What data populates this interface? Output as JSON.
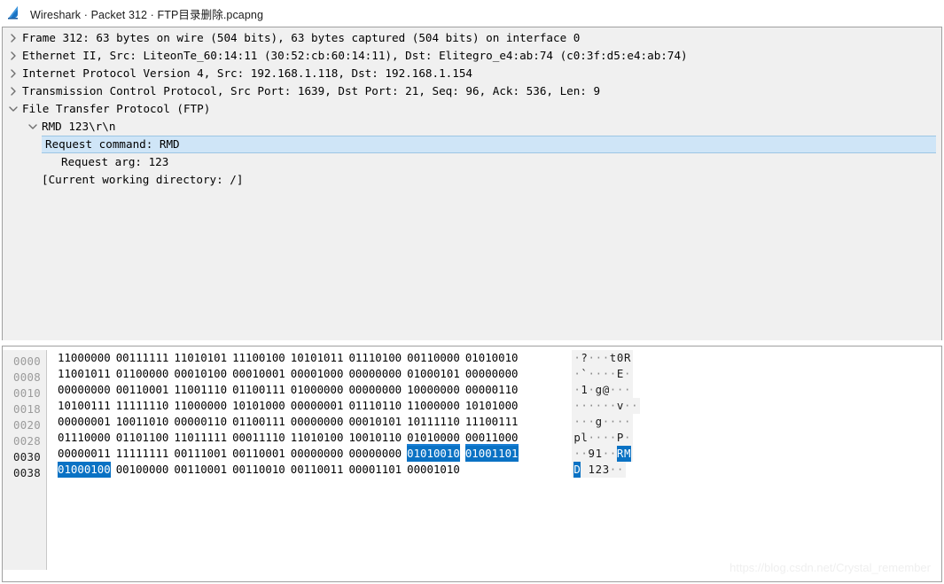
{
  "window": {
    "title": "Wireshark · Packet 312 · FTP目录删除.pcapng",
    "icon": "wireshark-fin-icon"
  },
  "detail_tree": {
    "rows": [
      {
        "indent": 0,
        "state": "collapsed",
        "text": "Frame 312: 63 bytes on wire (504 bits), 63 bytes captured (504 bits) on interface 0",
        "selected": false
      },
      {
        "indent": 0,
        "state": "collapsed",
        "text": "Ethernet II, Src: LiteonTe_60:14:11 (30:52:cb:60:14:11), Dst: Elitegro_e4:ab:74 (c0:3f:d5:e4:ab:74)",
        "selected": false
      },
      {
        "indent": 0,
        "state": "collapsed",
        "text": "Internet Protocol Version 4, Src: 192.168.1.118, Dst: 192.168.1.154",
        "selected": false
      },
      {
        "indent": 0,
        "state": "collapsed",
        "text": "Transmission Control Protocol, Src Port: 1639, Dst Port: 21, Seq: 96, Ack: 536, Len: 9",
        "selected": false
      },
      {
        "indent": 0,
        "state": "expanded",
        "text": "File Transfer Protocol (FTP)",
        "selected": false
      },
      {
        "indent": 1,
        "state": "expanded",
        "text": "RMD 123\\r\\n",
        "selected": false
      },
      {
        "indent": 2,
        "state": "leaf",
        "text": "Request command: RMD",
        "selected": true
      },
      {
        "indent": 2,
        "state": "leaf",
        "text": "Request arg: 123",
        "selected": false
      },
      {
        "indent": 1,
        "state": "leaf",
        "text": "[Current working directory: /]",
        "selected": false
      }
    ]
  },
  "bytes_pane": {
    "display_mode": "binary",
    "rows": [
      {
        "offset": "0000",
        "offset_hot": false,
        "bytes": [
          "11000000",
          "00111111",
          "11010101",
          "11100100",
          "10101011",
          "01110100",
          "00110000",
          "01010010"
        ],
        "highlight": [
          false,
          false,
          false,
          false,
          false,
          false,
          false,
          false
        ],
        "underline": [
          false,
          false,
          false,
          false,
          false,
          false,
          false,
          false
        ],
        "ascii": "·?···t0R",
        "ascii_highlight": [
          false,
          false,
          false,
          false,
          false,
          false,
          false,
          false
        ]
      },
      {
        "offset": "0008",
        "offset_hot": false,
        "bytes": [
          "11001011",
          "01100000",
          "00010100",
          "00010001",
          "00001000",
          "00000000",
          "01000101",
          "00000000"
        ],
        "highlight": [
          false,
          false,
          false,
          false,
          false,
          false,
          false,
          false
        ],
        "underline": [
          false,
          false,
          false,
          false,
          false,
          false,
          false,
          false
        ],
        "ascii": "·`····E·",
        "ascii_highlight": [
          false,
          false,
          false,
          false,
          false,
          false,
          false,
          false
        ]
      },
      {
        "offset": "0010",
        "offset_hot": false,
        "bytes": [
          "00000000",
          "00110001",
          "11001110",
          "01100111",
          "01000000",
          "00000000",
          "10000000",
          "00000110"
        ],
        "highlight": [
          false,
          false,
          false,
          false,
          false,
          false,
          false,
          false
        ],
        "underline": [
          false,
          false,
          false,
          false,
          false,
          false,
          false,
          false
        ],
        "ascii": "·1·g@···",
        "ascii_highlight": [
          false,
          false,
          false,
          false,
          false,
          false,
          false,
          false
        ]
      },
      {
        "offset": "0018",
        "offset_hot": false,
        "bytes": [
          "10100111",
          "11111110",
          "11000000",
          "10101000",
          "00000001",
          "01110110",
          "11000000",
          "10101000"
        ],
        "highlight": [
          false,
          false,
          false,
          false,
          false,
          false,
          false,
          false
        ],
        "underline": [
          false,
          false,
          false,
          false,
          false,
          false,
          false,
          false
        ],
        "ascii": "······v··",
        "ascii_highlight": [
          false,
          false,
          false,
          false,
          false,
          false,
          false,
          false
        ]
      },
      {
        "offset": "0020",
        "offset_hot": false,
        "bytes": [
          "00000001",
          "10011010",
          "00000110",
          "01100111",
          "00000000",
          "00010101",
          "10111110",
          "11100111"
        ],
        "highlight": [
          false,
          false,
          false,
          false,
          false,
          false,
          false,
          false
        ],
        "underline": [
          false,
          false,
          false,
          false,
          false,
          false,
          false,
          false
        ],
        "ascii": "···g····",
        "ascii_highlight": [
          false,
          false,
          false,
          false,
          false,
          false,
          false,
          false
        ]
      },
      {
        "offset": "0028",
        "offset_hot": false,
        "bytes": [
          "01110000",
          "01101100",
          "11011111",
          "00011110",
          "11010100",
          "10010110",
          "01010000",
          "00011000"
        ],
        "highlight": [
          false,
          false,
          false,
          false,
          false,
          false,
          false,
          false
        ],
        "underline": [
          false,
          false,
          false,
          false,
          false,
          false,
          true,
          true
        ],
        "ascii": "pl····P·",
        "ascii_highlight": [
          false,
          false,
          false,
          false,
          false,
          false,
          false,
          false
        ]
      },
      {
        "offset": "0030",
        "offset_hot": true,
        "bytes": [
          "00000011",
          "11111111",
          "00111001",
          "00110001",
          "00000000",
          "00000000",
          "01010010",
          "01001101"
        ],
        "highlight": [
          false,
          false,
          false,
          false,
          false,
          false,
          true,
          true
        ],
        "underline": [
          false,
          false,
          false,
          false,
          false,
          false,
          false,
          false
        ],
        "ascii": "··91··RM",
        "ascii_highlight": [
          false,
          false,
          false,
          false,
          false,
          false,
          true,
          true
        ]
      },
      {
        "offset": "0038",
        "offset_hot": true,
        "bytes": [
          "01000100",
          "00100000",
          "00110001",
          "00110010",
          "00110011",
          "00001101",
          "00001010"
        ],
        "highlight": [
          true,
          false,
          false,
          false,
          false,
          false,
          false
        ],
        "underline": [
          false,
          false,
          false,
          false,
          false,
          false,
          false
        ],
        "ascii": "D 123··",
        "ascii_highlight": [
          true,
          false,
          false,
          false,
          false,
          false,
          false
        ]
      }
    ]
  },
  "watermark": {
    "text": "https://blog.csdn.net/Crystal_remember"
  },
  "colors": {
    "selection_blue": "#0a72c4",
    "row_selection": "#cfe5f7",
    "pane_bg": "#f0f0f0",
    "offset_gray": "#9b9b9b"
  }
}
